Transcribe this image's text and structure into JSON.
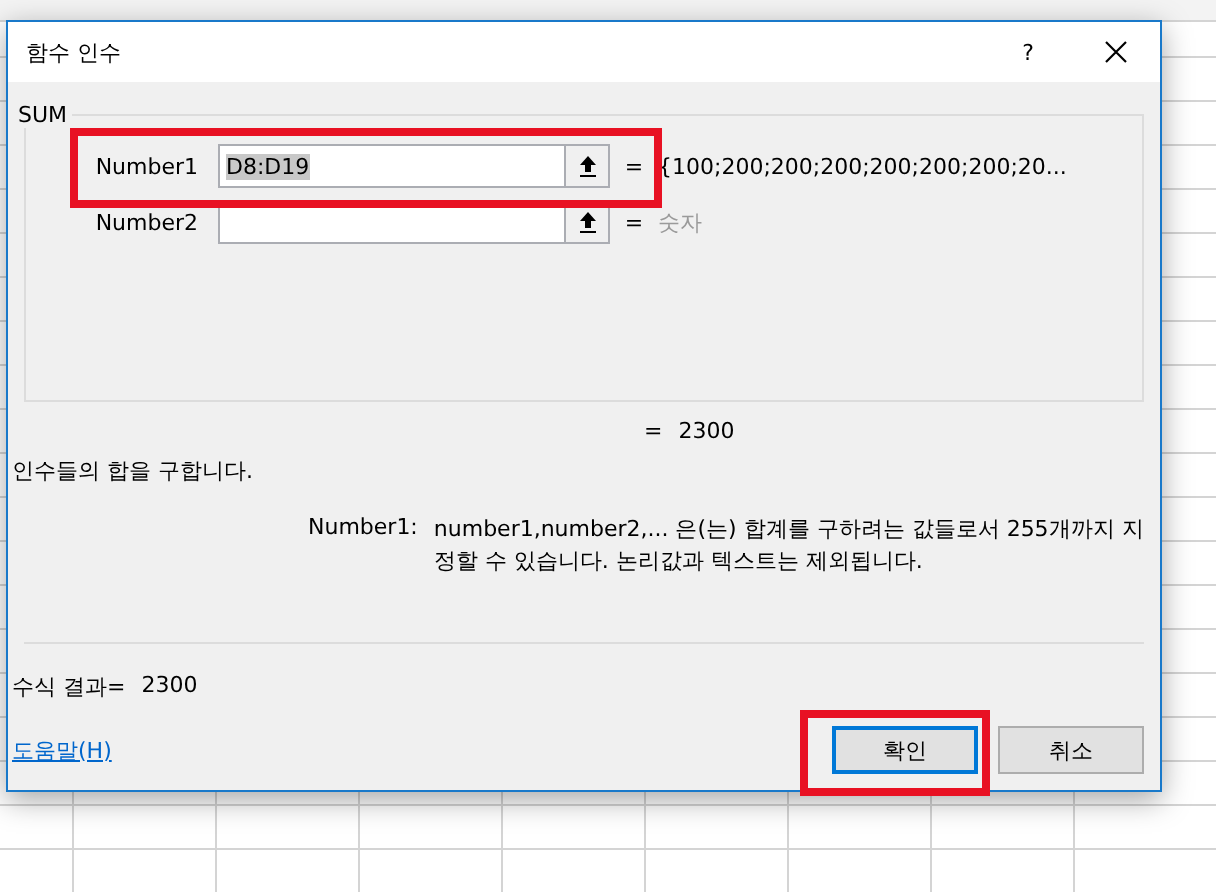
{
  "dialog": {
    "title": "함수 인수",
    "help_button": "?"
  },
  "function_group": {
    "name": "SUM",
    "arguments": [
      {
        "label": "Number1",
        "value": "D8:D19",
        "value_selected": true,
        "sign": "=",
        "result": {
          "kind": "value",
          "text": "{100;200;200;200;200;200;200;20..."
        },
        "highlighted": true
      },
      {
        "label": "Number2",
        "sign": "=",
        "result": {
          "kind": "hint",
          "text": "숫자"
        },
        "highlighted": false
      }
    ]
  },
  "total": {
    "sign": "=",
    "value": "2300"
  },
  "description": "인수들의 합을 구합니다.",
  "argument_help": {
    "label": "Number1:",
    "text": "number1,number2,... 은(는) 합계를 구하려는 값들로서 255개까지 지정할 수 있습니다. 논리값과 텍스트는 제외됩니다."
  },
  "formula_result": {
    "label": "수식 결과=",
    "value": "2300"
  },
  "help_link": "도움말(H)",
  "buttons": [
    {
      "label": "확인",
      "default": true,
      "highlighted": true
    },
    {
      "label": "취소",
      "default": false,
      "highlighted": false
    }
  ]
}
